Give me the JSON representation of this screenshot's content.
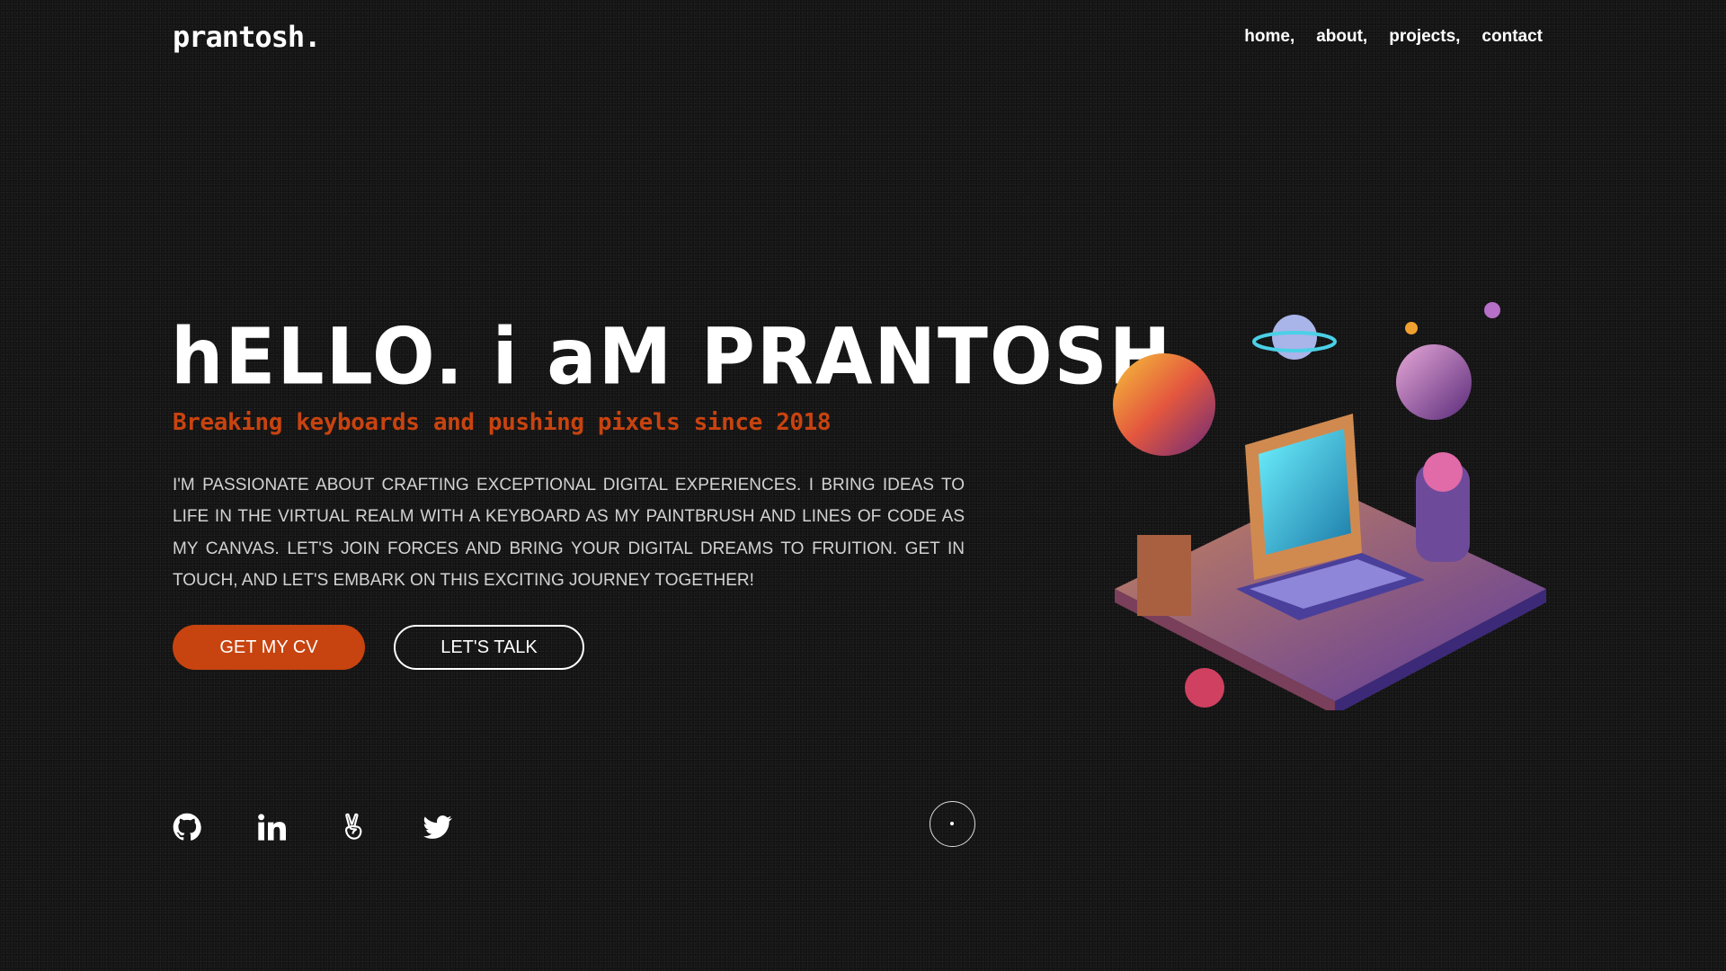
{
  "header": {
    "logo": "prantosh.",
    "nav": [
      {
        "label": "home,"
      },
      {
        "label": "about,"
      },
      {
        "label": "projects,"
      },
      {
        "label": "contact"
      }
    ]
  },
  "hero": {
    "title": "hELLO. i aM PRANTOSH",
    "subtitle": "Breaking keyboards and pushing pixels since 2018",
    "description": "I'm passionate about crafting exceptional digital experiences. I bring ideas to life in the virtual realm with a keyboard as my paintbrush and lines of code as my canvas. Let's join forces and bring your digital dreams to fruition. Get in touch, and let's embark on this exciting journey together!",
    "cv_button": "GET MY CV",
    "talk_button": "LET'S TALK"
  },
  "social": [
    {
      "icon": "github-icon"
    },
    {
      "icon": "linkedin-icon"
    },
    {
      "icon": "angellist-icon"
    },
    {
      "icon": "twitter-icon"
    }
  ],
  "colors": {
    "accent": "#c7430f",
    "background": "#121212",
    "text": "#ffffff"
  }
}
